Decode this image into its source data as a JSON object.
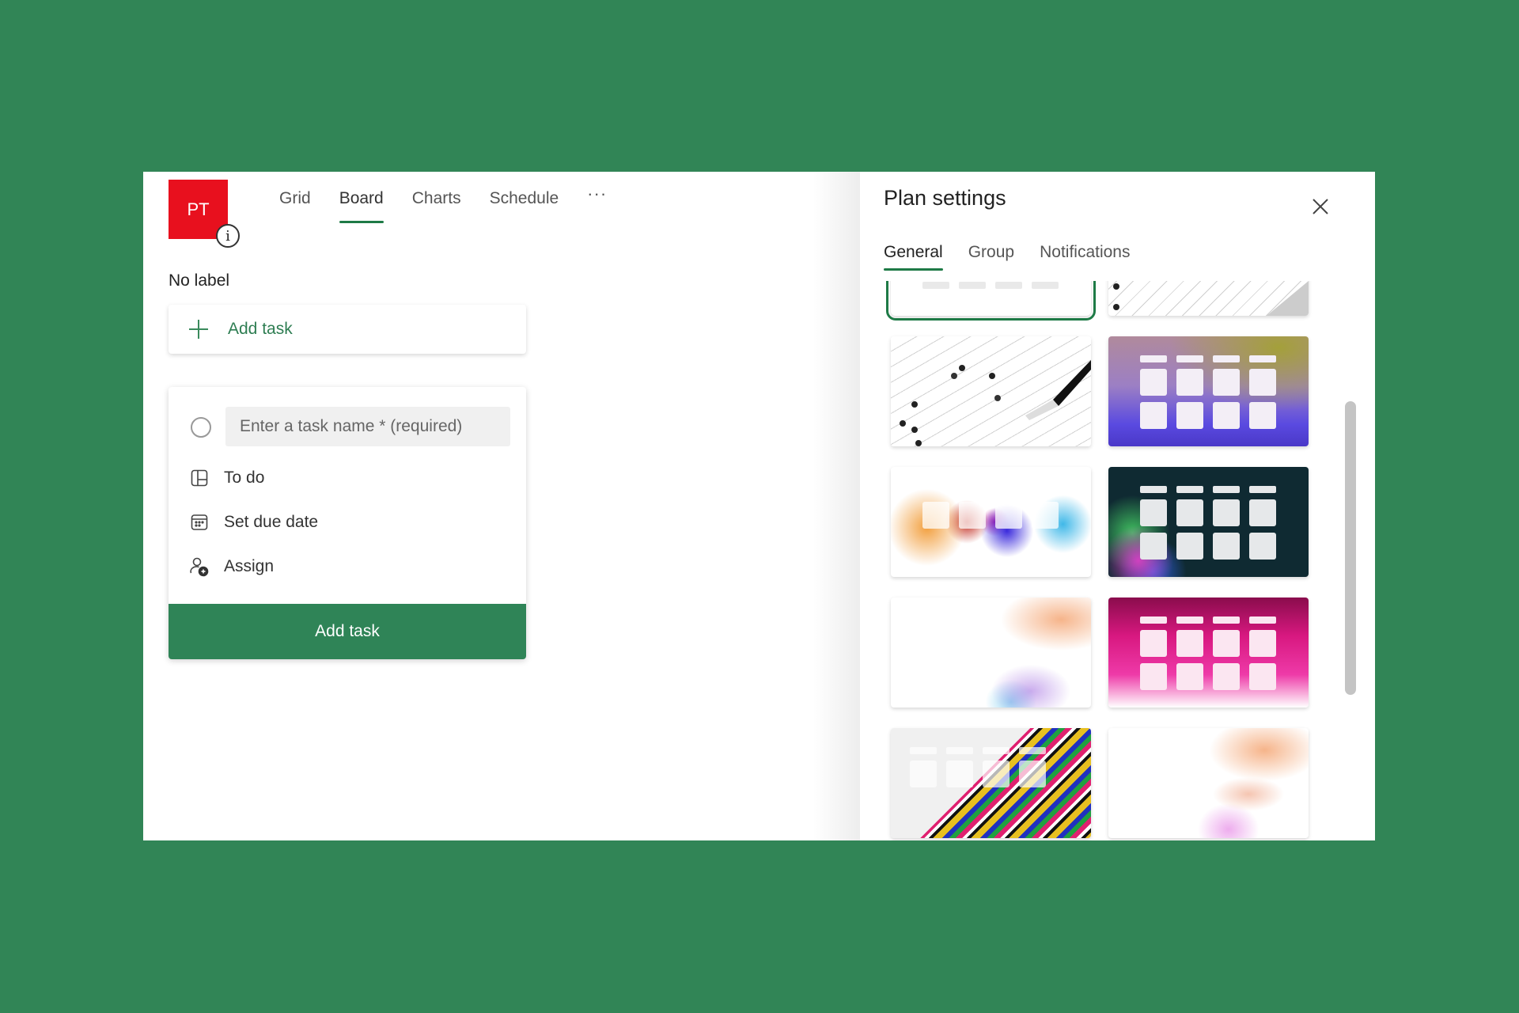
{
  "plan": {
    "initials": "PT",
    "avatar_color": "#e8101e",
    "info_icon": "info-icon"
  },
  "nav_tabs": [
    {
      "label": "Grid",
      "active": false
    },
    {
      "label": "Board",
      "active": true
    },
    {
      "label": "Charts",
      "active": false
    },
    {
      "label": "Schedule",
      "active": false
    }
  ],
  "nav_more": "···",
  "bucket": {
    "label": "No label",
    "add_task_label": "Add task"
  },
  "new_task": {
    "placeholder": "Enter a task name * (required)",
    "value": "",
    "options": [
      {
        "icon": "bucket-icon",
        "label": "To do"
      },
      {
        "icon": "calendar-icon",
        "label": "Set due date"
      },
      {
        "icon": "assign-person-icon",
        "label": "Assign"
      }
    ],
    "submit_label": "Add task"
  },
  "settings": {
    "title": "Plan settings",
    "close_icon": "close-icon",
    "tabs": [
      {
        "label": "General",
        "active": true
      },
      {
        "label": "Group",
        "active": false
      },
      {
        "label": "Notifications",
        "active": false
      }
    ],
    "backgrounds": [
      {
        "name": "plain-white",
        "selected": true
      },
      {
        "name": "answer-sheet-pencil",
        "selected": false
      },
      {
        "name": "answer-sheet-pencil-closeup",
        "selected": false
      },
      {
        "name": "purple-gradient-board",
        "selected": false
      },
      {
        "name": "rainbow-splatter",
        "selected": false
      },
      {
        "name": "dark-teal-bokeh-board",
        "selected": false
      },
      {
        "name": "orange-dots-corner",
        "selected": false
      },
      {
        "name": "magenta-gradient-board",
        "selected": false
      },
      {
        "name": "colorful-stripes",
        "selected": false
      },
      {
        "name": "orange-pink-dots-corner",
        "selected": false
      }
    ]
  },
  "colors": {
    "page_background": "#318556",
    "accent": "#1e7a46",
    "primary_button": "#2f8457"
  }
}
